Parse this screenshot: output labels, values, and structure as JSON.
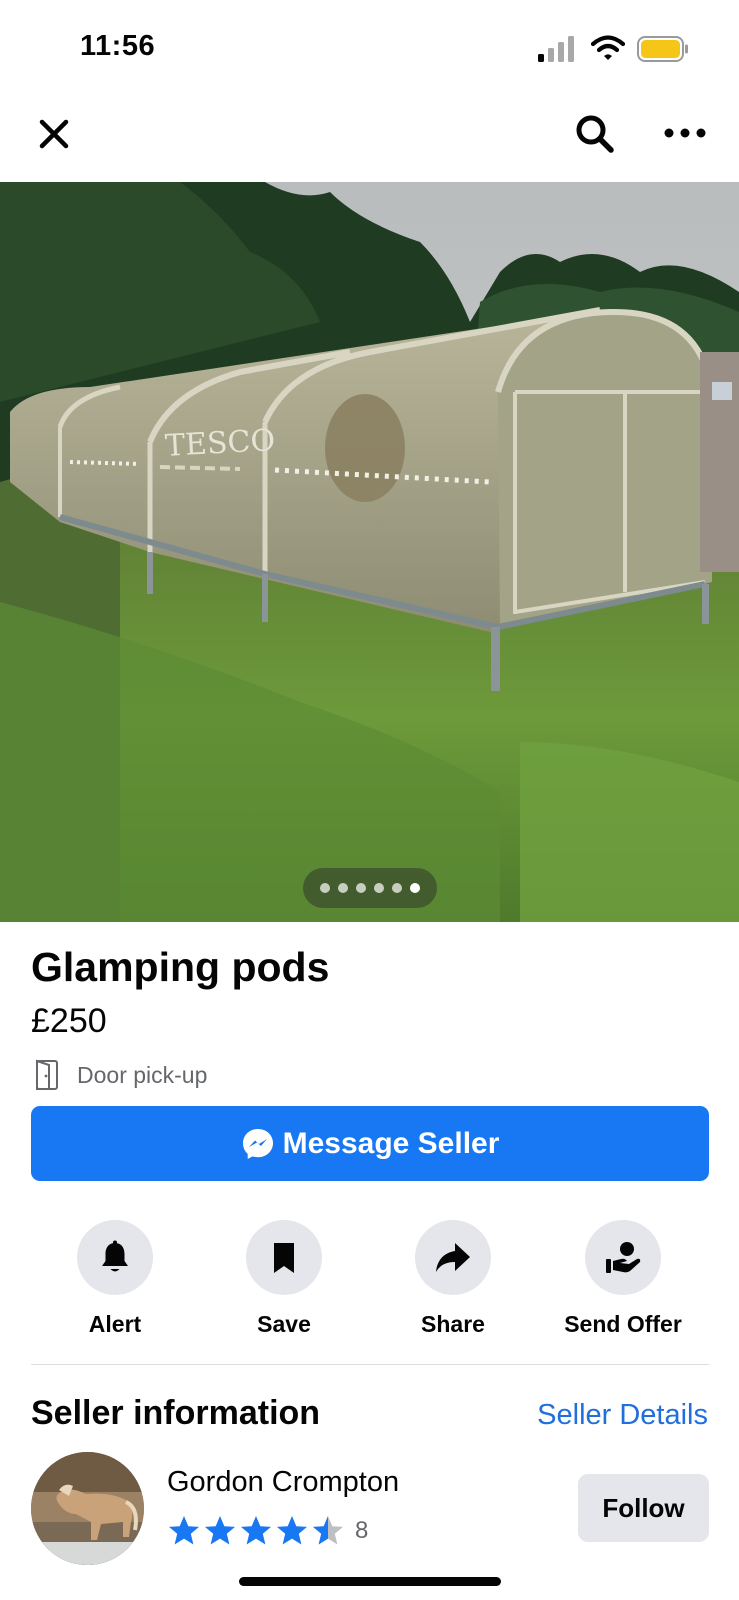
{
  "status_bar": {
    "time": "11:56",
    "signal_icon": "cellular-signal-icon",
    "wifi_icon": "wifi-icon",
    "battery_icon": "battery-icon",
    "battery_color": "#f5c518"
  },
  "nav": {
    "close_icon": "close-icon",
    "search_icon": "search-icon",
    "more_icon": "more-options-icon"
  },
  "photo": {
    "printed_text": "TESCO",
    "carousel": {
      "total": 6,
      "active_index": 5
    }
  },
  "listing": {
    "title": "Glamping pods",
    "price": "£250",
    "pickup_icon": "door-icon",
    "pickup_text": "Door pick-up"
  },
  "primary_action": {
    "label": "Message Seller",
    "icon": "messenger-icon",
    "color": "#1877f2"
  },
  "actions": [
    {
      "label": "Alert",
      "icon": "bell-icon"
    },
    {
      "label": "Save",
      "icon": "bookmark-icon"
    },
    {
      "label": "Share",
      "icon": "share-arrow-icon"
    },
    {
      "label": "Send Offer",
      "icon": "offer-hand-icon"
    }
  ],
  "seller": {
    "heading": "Seller information",
    "details_link": "Seller Details",
    "name": "Gordon Crompton",
    "rating": 4.5,
    "rating_max": 5,
    "review_count": "8",
    "follow_label": "Follow",
    "avatar_description_icon": "avatar-horse-photo",
    "star_color": "#1877f2",
    "link_color": "#216fdb"
  }
}
